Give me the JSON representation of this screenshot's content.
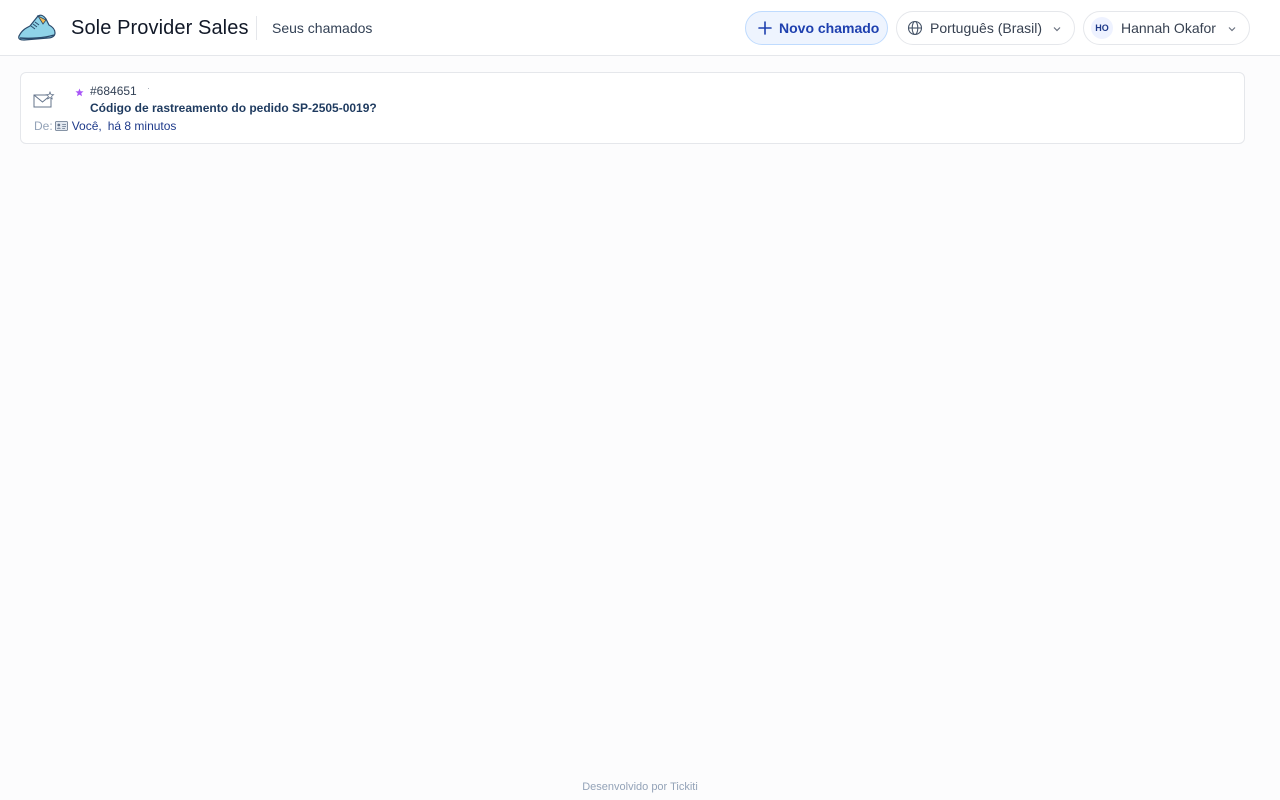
{
  "header": {
    "brand": "Sole Provider Sales",
    "nav_link": "Seus chamados",
    "new_ticket_label": "Novo chamado",
    "language_label": "Português (Brasil)",
    "user_initials": "HO",
    "user_name": "Hannah Okafor"
  },
  "tickets": [
    {
      "id": "#684651",
      "separator": "·",
      "subject": "Código de rastreamento do pedido SP-2505-0019?",
      "from_label": "De:",
      "from_name": "Você,",
      "time": "há 8 minutos"
    }
  ],
  "footer": {
    "text": "Desenvolvido por Tickiti"
  },
  "icons": {
    "logo": "sneaker-logo-icon",
    "plus": "plus-icon",
    "globe": "globe-icon",
    "chevron": "chevron-down-icon",
    "mail": "mail-star-icon",
    "star": "star-icon",
    "contact_card": "contact-card-icon"
  },
  "colors": {
    "accent": "#1e40af",
    "accent_bg": "#eef4fe",
    "star": "#a855f7",
    "page_bg": "#fcfcfd"
  }
}
